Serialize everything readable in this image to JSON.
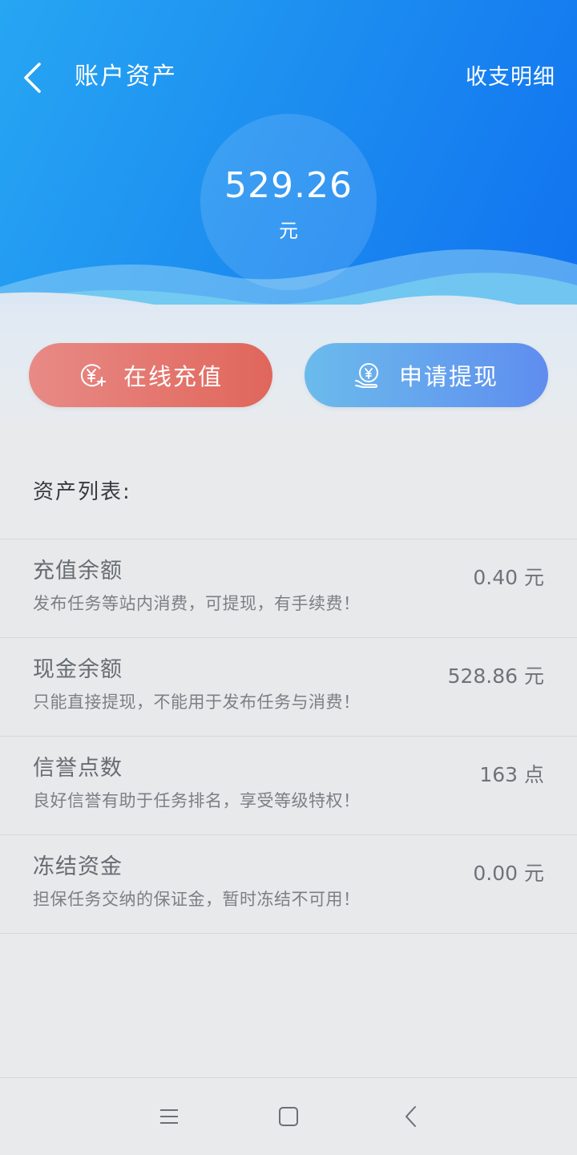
{
  "header": {
    "title": "账户资产",
    "detail_link": "收支明细"
  },
  "balance": {
    "amount": "529.26",
    "unit": "元"
  },
  "actions": {
    "recharge_label": "在线充值",
    "withdraw_label": "申请提现"
  },
  "assets": {
    "section_title": "资产列表:",
    "items": [
      {
        "name": "充值余额",
        "desc": "发布任务等站内消费，可提现，有手续费！",
        "value": "0.40 元"
      },
      {
        "name": "现金余额",
        "desc": "只能直接提现，不能用于发布任务与消费！",
        "value": "528.86 元"
      },
      {
        "name": "信誉点数",
        "desc": "良好信誉有助于任务排名，享受等级特权！",
        "value": "163 点"
      },
      {
        "name": "冻结资金",
        "desc": "担保任务交纳的保证金，暂时冻结不可用！",
        "value": "0.00 元"
      }
    ]
  },
  "icons": {
    "back": "chevron-left-icon",
    "recharge": "yen-add-icon",
    "withdraw": "yen-hand-icon",
    "nav_menu": "menu-icon",
    "nav_home": "square-icon",
    "nav_back": "back-icon"
  },
  "colors": {
    "header_start": "#27a6f3",
    "header_end": "#0f6ef0",
    "recharge_button": "#e0665b",
    "withdraw_button": "#5f8def",
    "background": "#e9eaeb"
  }
}
